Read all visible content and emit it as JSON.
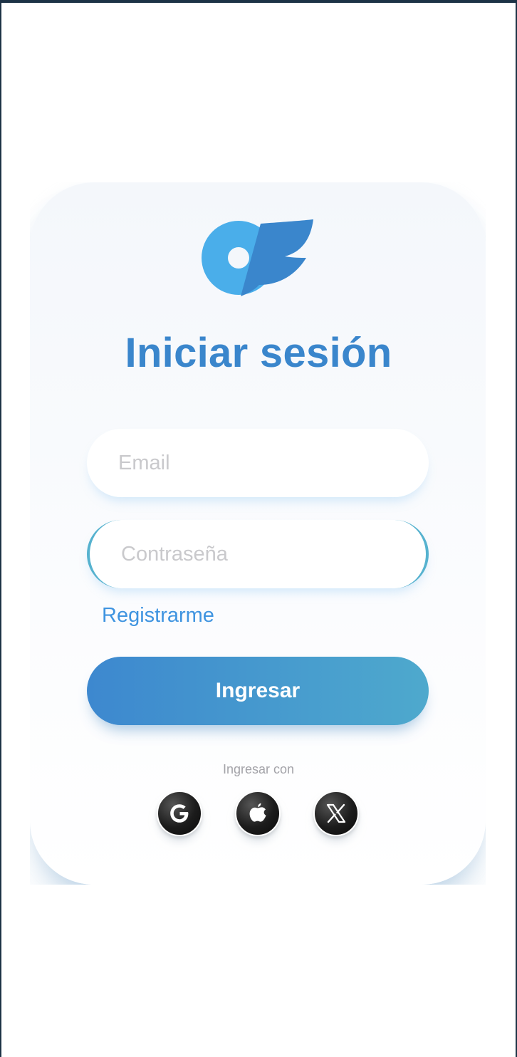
{
  "header": {
    "title": "Iniciar sesión"
  },
  "form": {
    "email_placeholder": "Email",
    "password_placeholder": "Contraseña",
    "register_label": "Registrarme",
    "submit_label": "Ingresar"
  },
  "social": {
    "label": "Ingresar con",
    "providers": [
      {
        "name": "google",
        "icon": "google-icon"
      },
      {
        "name": "apple",
        "icon": "apple-icon"
      },
      {
        "name": "x",
        "icon": "x-icon"
      }
    ]
  },
  "colors": {
    "brand": "#3a86cc",
    "logo_light": "#4aaeea",
    "logo_dark": "#3a86cc",
    "link": "#3f94e0",
    "button_gradient_start": "#3d88cf",
    "button_gradient_end": "#4ea9cd",
    "input_focus_border": "#56b2cf"
  }
}
